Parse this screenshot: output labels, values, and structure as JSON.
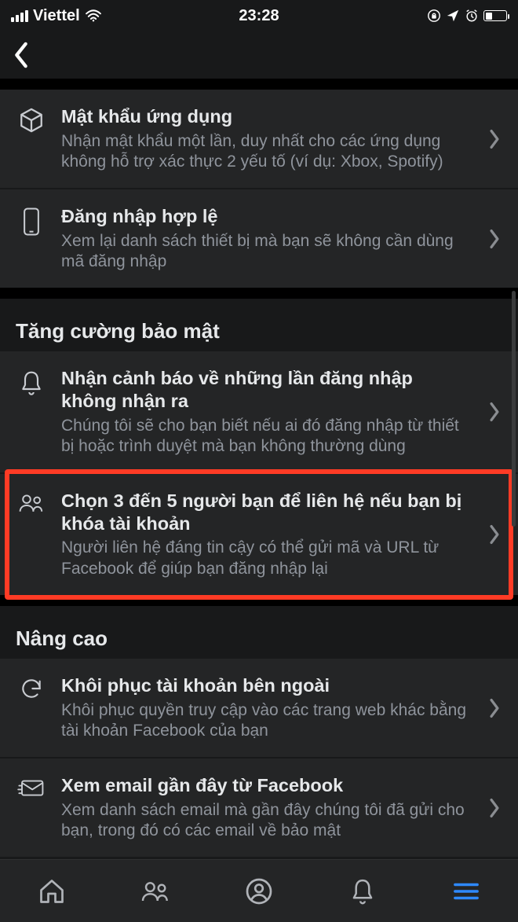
{
  "status": {
    "carrier": "Viettel",
    "time": "23:28"
  },
  "sections": [
    {
      "items": [
        {
          "icon": "box",
          "title": "Mật khẩu ứng dụng",
          "sub": "Nhận mật khẩu một lần, duy nhất cho các ứng dụng không hỗ trợ xác thực 2 yếu tố (ví dụ: Xbox, Spotify)"
        },
        {
          "icon": "phone",
          "title": "Đăng nhập hợp lệ",
          "sub": "Xem lại danh sách thiết bị mà bạn sẽ không cần dùng mã đăng nhập"
        }
      ]
    },
    {
      "heading": "Tăng cường bảo mật",
      "items": [
        {
          "icon": "bell",
          "title": "Nhận cảnh báo về những lần đăng nhập không nhận ra",
          "sub": "Chúng tôi sẽ cho bạn biết nếu ai đó đăng nhập từ thiết bị hoặc trình duyệt mà bạn không thường dùng"
        },
        {
          "icon": "friends",
          "title": "Chọn 3 đến 5 người bạn để liên hệ nếu bạn bị khóa tài khoản",
          "sub": "Người liên hệ đáng tin cậy có thể gửi mã và URL từ Facebook để giúp bạn đăng nhập lại",
          "highlight": true
        }
      ]
    },
    {
      "heading": "Nâng cao",
      "items": [
        {
          "icon": "refresh",
          "title": "Khôi phục tài khoản bên ngoài",
          "sub": "Khôi phục quyền truy cập vào các trang web khác bằng tài khoản Facebook của bạn"
        },
        {
          "icon": "mail",
          "title": "Xem email gần đây từ Facebook",
          "sub": "Xem danh sách email mà gần đây chúng tôi đã gửi cho bạn, trong đó có các email về bảo mật"
        }
      ]
    }
  ],
  "highlight_color": "#ff3b25",
  "tabbar_active": "menu"
}
